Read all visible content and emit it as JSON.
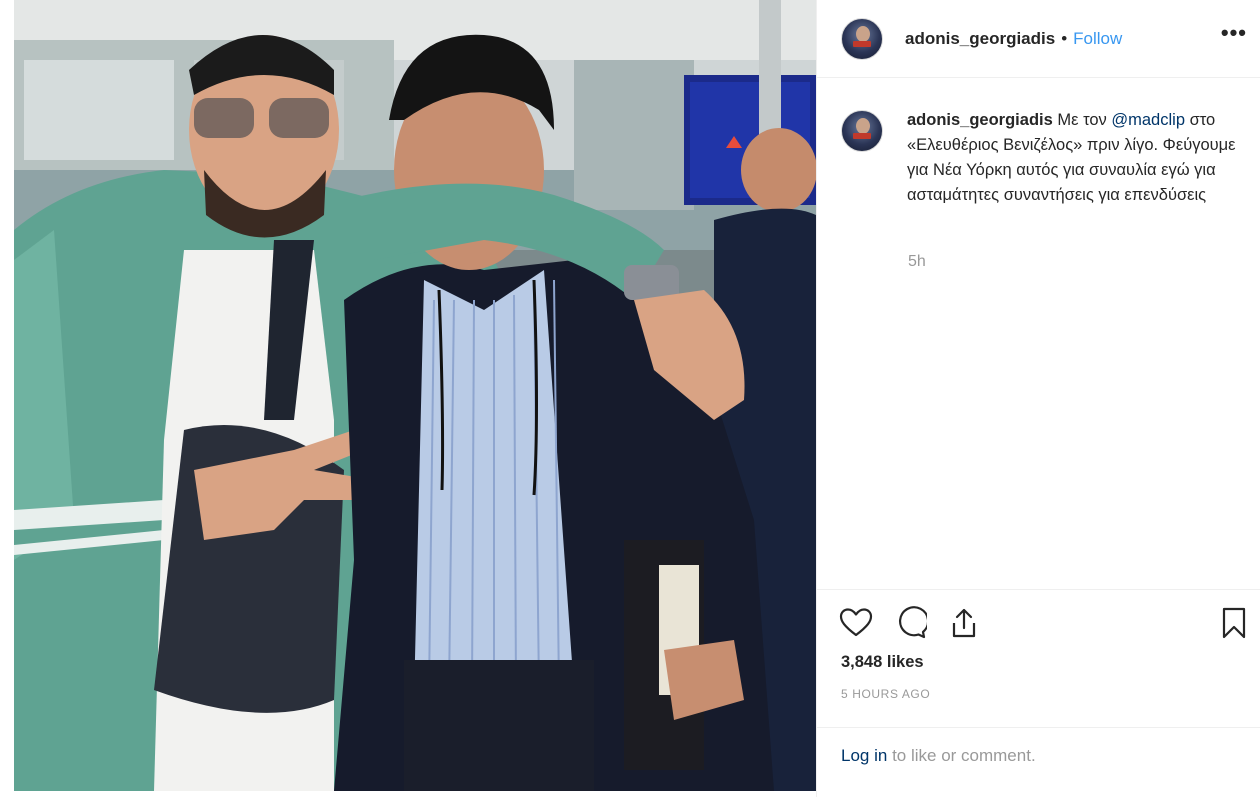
{
  "post": {
    "username": "adonis_georgiadis",
    "separator": "•",
    "follow_label": "Follow",
    "more_label": "•••"
  },
  "caption": {
    "username": "adonis_georgiadis",
    "text_before": "Με τον",
    "mention": "@madclip",
    "text_after": "στο «Ελευθέριος Βενιζέλος» πριν λίγο. Φεύγουμε για Νέα Υόρκη αυτός για συναυλία εγώ για ασταμάτητες συναντήσεις για επενδύσεις",
    "time": "5h"
  },
  "actions": {
    "like_icon": "heart-icon",
    "comment_icon": "comment-bubble-icon",
    "share_icon": "share-upload-icon",
    "save_icon": "bookmark-icon"
  },
  "likes_text": "3,848 likes",
  "posted_ago": "5 HOURS AGO",
  "footer": {
    "login_label": "Log in",
    "login_suffix": "to like or comment."
  },
  "colors": {
    "link_blue": "#3897f0",
    "dark_link": "#003569",
    "muted": "#999999",
    "text": "#262626",
    "border": "#efefef"
  }
}
